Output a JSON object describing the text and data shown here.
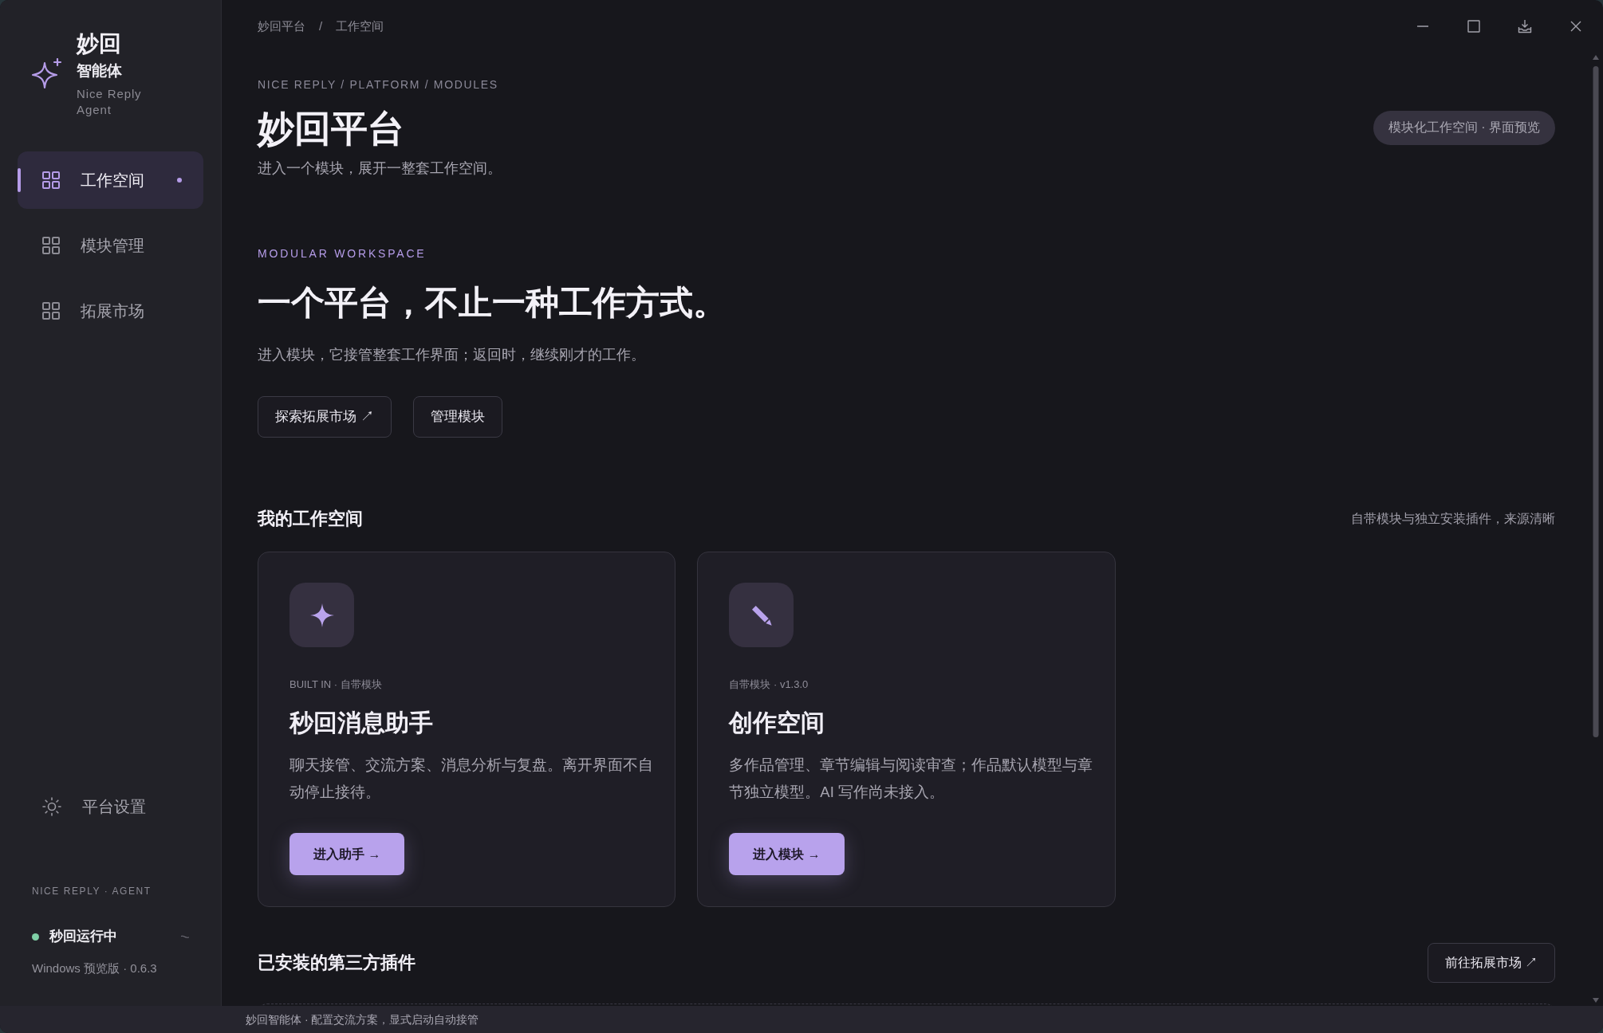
{
  "sidebar": {
    "brand": {
      "name": "妙回",
      "subtitle": "智能体",
      "tagline": "Nice Reply Agent"
    },
    "nav": [
      {
        "label": "工作空间",
        "selected": true
      },
      {
        "label": "模块管理",
        "selected": false
      },
      {
        "label": "拓展市场",
        "selected": false
      }
    ],
    "settings": {
      "label": "平台设置",
      "selected": false
    },
    "footer": {
      "caption": "NICE REPLY · AGENT",
      "status": {
        "label": "秒回运行中",
        "running": true
      },
      "version": "Windows 预览版 · 0.6.3"
    }
  },
  "top_bar": {
    "breadcrumb": {
      "items": [
        "妙回平台",
        "工作空间"
      ],
      "separator": "/"
    }
  },
  "header": {
    "eyebrow": "NICE REPLY / PLATFORM / MODULES",
    "title": "妙回平台",
    "subtitle": "进入一个模块，展开一整套工作空间。",
    "badge": "模块化工作空间 · 界面预览"
  },
  "hero": {
    "eyebrow": "MODULAR WORKSPACE",
    "title": "一个平台，不止一种工作方式。",
    "text": "进入模块，它接管整套工作界面；返回时，继续刚才的工作。",
    "buttons": [
      "探索拓展市场 ↗",
      "管理模块"
    ]
  },
  "workspaces": {
    "title": "我的工作空间",
    "note": "自带模块与独立安装插件，来源清晰",
    "cards": [
      {
        "kind": "assistant",
        "meta": "BUILT IN · 自带模块",
        "title": "秒回消息助手",
        "description": "聊天接管、交流方案、消息分析与复盘。离开界面不自动停止接待。",
        "button": "进入助手 →"
      },
      {
        "kind": "writing",
        "meta": "自带模块 · v1.3.0",
        "title": "创作空间",
        "description": "多作品管理、章节编辑与阅读审查；作品默认模型与章节独立模型。AI 写作尚未接入。",
        "button": "进入模块 →"
      }
    ]
  },
  "plugins": {
    "title": "已安装的第三方插件",
    "button": "前往拓展市场 ↗"
  },
  "status_bar": {
    "text": "妙回智能体 · 配置交流方案，显式启动自动接管"
  }
}
